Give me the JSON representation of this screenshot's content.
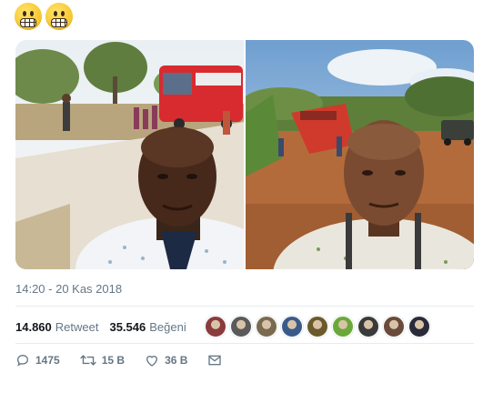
{
  "tweet": {
    "emojis": [
      "grimacing-face",
      "grimacing-face"
    ],
    "timestamp": "14:20 - 20 Kas 2018"
  },
  "stats": {
    "retweet_count": "14.860",
    "retweet_label": "Retweet",
    "like_count": "35.546",
    "like_label": "Beğeni",
    "liker_avatar_colors": [
      "#8a3b3b",
      "#5a5a5a",
      "#7a6a50",
      "#3a5a8a",
      "#6b5a2a",
      "#6aa83a",
      "#3a3a3a",
      "#6a4a3a",
      "#2a2a3a"
    ]
  },
  "actions": {
    "reply_count": "1475",
    "retweet_count": "15 B",
    "like_count": "36 B"
  },
  "colors": {
    "text_primary": "#14171a",
    "text_secondary": "#657786",
    "divider": "#e6ecf0"
  }
}
